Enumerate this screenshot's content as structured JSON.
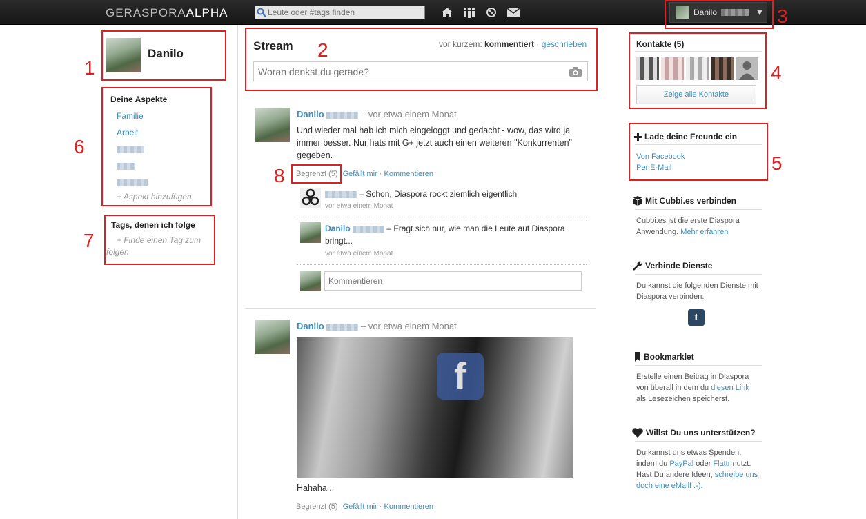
{
  "header": {
    "logo_main": "GERASPORA",
    "logo_suffix": "ALPHA",
    "search_placeholder": "Leute oder #tags finden",
    "nav_icons": [
      "home-icon",
      "contacts-icon",
      "mentions-icon",
      "mail-icon"
    ],
    "user_name": "Danilo",
    "dropdown_arrow": "▼"
  },
  "annotations": [
    "1",
    "2",
    "3",
    "4",
    "5",
    "6",
    "7",
    "8"
  ],
  "profile": {
    "name": "Danilo"
  },
  "aspects": {
    "title": "Deine Aspekte",
    "items": [
      "Familie",
      "Arbeit"
    ],
    "add_label": "+ Aspekt hinzufügen"
  },
  "tags": {
    "title": "Tags, denen ich folge",
    "find_label": "+ Finde einen Tag zum folgen"
  },
  "stream": {
    "title": "Stream",
    "sort_prefix": "vor kurzem:",
    "sort_active": "kommentiert",
    "sort_sep": "·",
    "sort_other": "geschrieben",
    "publisher_placeholder": "Woran denkst du gerade?"
  },
  "posts": [
    {
      "author": "Danilo",
      "time": "– vor etwa einem Monat",
      "text": "Und wieder mal hab ich mich eingeloggt und gedacht - wow, das wird ja immer besser. Nur hats mit G+ jetzt auch einen weiteren \"Konkurrenten\" gegeben.",
      "visibility": "Begrenzt (5)",
      "like": "Gefällt mir",
      "comment": "Kommentieren",
      "comments": [
        {
          "author": "",
          "text": "– Schon, Diaspora rockt ziemlich eigentlich",
          "time": "vor etwa einem Monat"
        },
        {
          "author": "Danilo",
          "text": "– Fragt sich nur, wie man die Leute auf Diaspora bringt...",
          "time": "vor etwa einem Monat"
        }
      ],
      "comment_placeholder": "Kommentieren"
    },
    {
      "author": "Danilo",
      "time": "– vor etwa einem Monat",
      "image_overlay": "f",
      "text": "Hahaha...",
      "visibility": "Begrenzt (5)",
      "like": "Gefällt mir",
      "comment": "Kommentieren"
    }
  ],
  "contacts": {
    "title": "Kontakte (5)",
    "button": "Zeige alle Kontakte"
  },
  "invite": {
    "title": "Lade deine Freunde ein",
    "facebook": "Von Facebook",
    "email": "Per E-Mail"
  },
  "cubbi": {
    "title": "Mit Cubbi.es verbinden",
    "text": "Cubbi.es ist die erste Diaspora Anwendung.",
    "link": "Mehr erfahren"
  },
  "services": {
    "title": "Verbinde Dienste",
    "text": "Du kannst die folgenden Dienste mit Diaspora verbinden:",
    "tumblr": "t"
  },
  "bookmarklet": {
    "title": "Bookmarklet",
    "text_before": "Erstelle einen Beitrag in Diaspora von überall in dem du",
    "link": "diesen Link",
    "text_after": "als Lesezeichen speicherst."
  },
  "support": {
    "title": "Willst Du uns unterstützen?",
    "text1": "Du kannst uns etwas Spenden, indem du",
    "paypal": "PayPal",
    "oder": "oder",
    "flattr": "Flattr",
    "text2": "nutzt. Hast Du andere Ideen,",
    "link": "schreibe uns doch eine eMail! :-)."
  },
  "colors": {
    "accent": "#3f8fba",
    "annotation": "#e02020",
    "header": "#1f1f1f"
  }
}
